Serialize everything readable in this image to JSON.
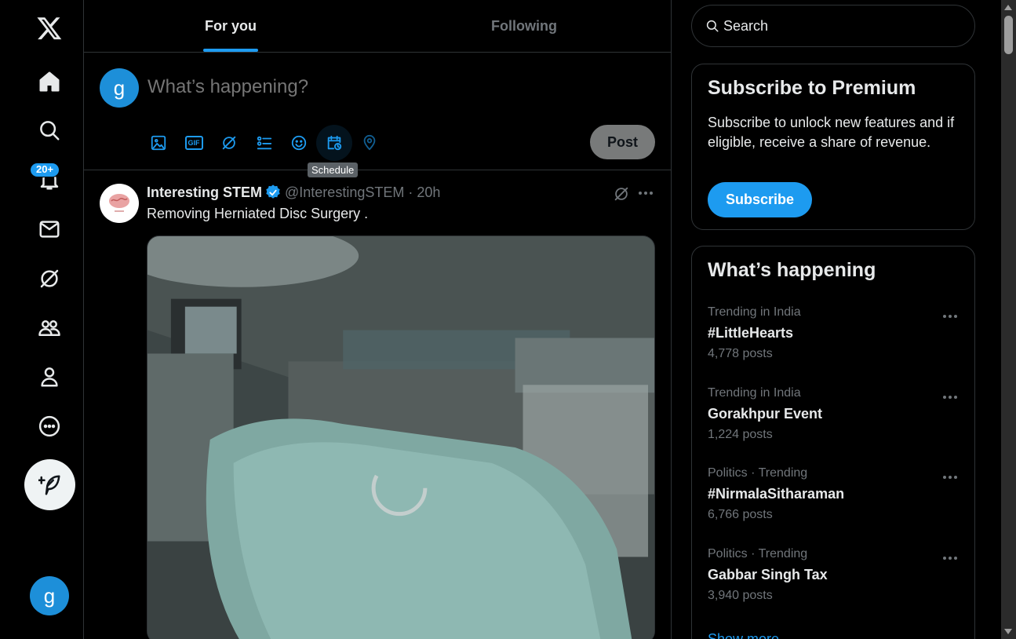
{
  "nav": {
    "notifications_badge": "20+",
    "user_initial": "g",
    "items": [
      "home-icon",
      "search-icon",
      "bell-icon",
      "mail-icon",
      "grok-icon",
      "communities-icon",
      "profile-icon",
      "more-icon"
    ]
  },
  "tabs": [
    {
      "label": "For you",
      "active": true
    },
    {
      "label": "Following",
      "active": false
    }
  ],
  "composer": {
    "user_initial": "g",
    "placeholder": "What’s happening?",
    "post_label": "Post",
    "tooltip": "Schedule",
    "gif_label": "GIF"
  },
  "tweet": {
    "name": "Interesting STEM",
    "handle": "@InterestingSTEM",
    "separator": "·",
    "time": "20h",
    "text": "Removing Herniated Disc Surgery ."
  },
  "search": {
    "placeholder": "Search"
  },
  "premium": {
    "title": "Subscribe to Premium",
    "description": "Subscribe to unlock new features and if eligible, receive a share of revenue.",
    "button": "Subscribe"
  },
  "happening": {
    "title": "What’s happening",
    "trends": [
      {
        "context": "Trending in India",
        "name": "#LittleHearts",
        "count": "4,778 posts"
      },
      {
        "context": "Trending in India",
        "name": "Gorakhpur Event",
        "count": "1,224 posts"
      },
      {
        "context": "Politics · Trending",
        "name": "#NirmalaSitharaman",
        "count": "6,766 posts"
      },
      {
        "context": "Politics · Trending",
        "name": "Gabbar Singh Tax",
        "count": "3,940 posts"
      }
    ],
    "show_more": "Show more"
  },
  "colors": {
    "accent": "#1d9bf0",
    "background": "#000000",
    "text": "#e7e9ea",
    "muted": "#71767b"
  }
}
